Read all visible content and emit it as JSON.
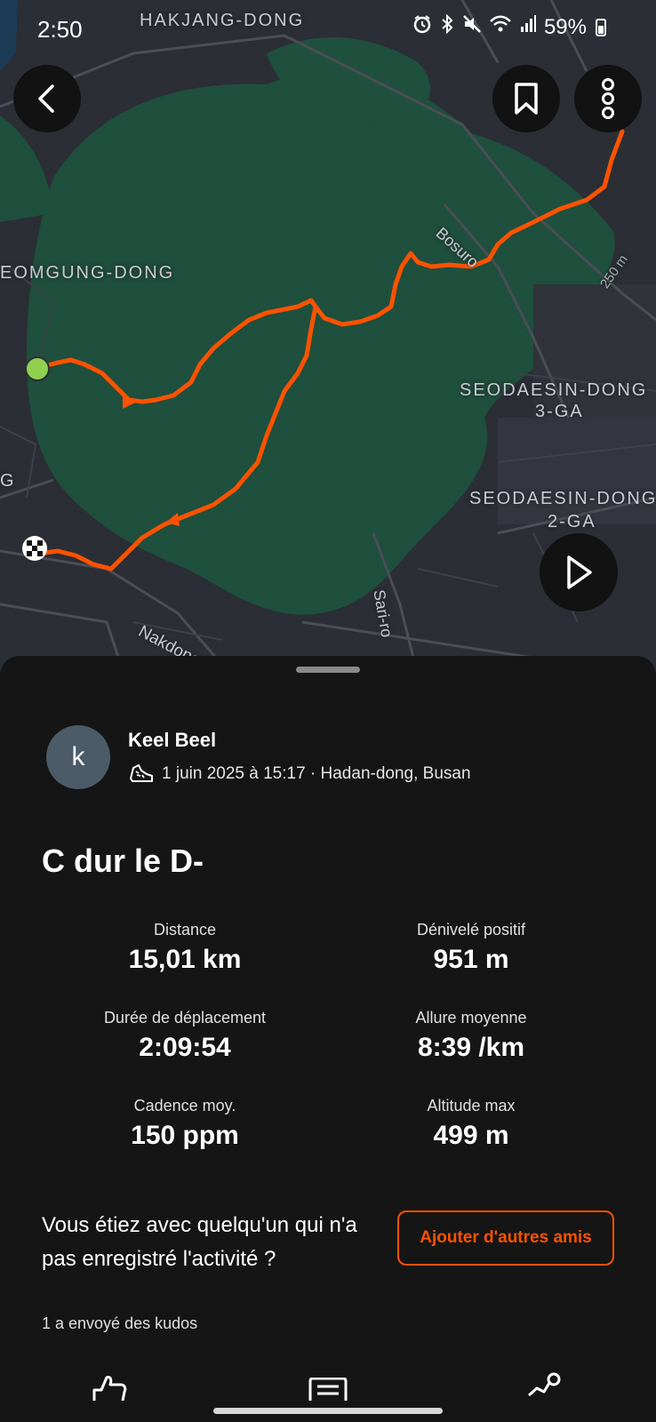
{
  "status_bar": {
    "time": "2:50",
    "battery": "59%",
    "icons": [
      "alarm-icon",
      "bluetooth-icon",
      "mute-icon",
      "wifi-icon",
      "signal-icon",
      "battery-icon"
    ]
  },
  "map": {
    "labels": {
      "hakjang": "HAKJANG-DONG",
      "geomgung": "EOMGUNG-DONG",
      "seodaesin3_line1": "SEODAESIN-DONG",
      "seodaesin3_line2": "3-GA",
      "seodaesin2_line1": "SEODAESIN-DONG",
      "seodaesin2_line2": "2-GA",
      "bosuro": "Bosuro",
      "sariro": "Sari-ro",
      "nakdong": "Nakdong-daero",
      "contour": "250 m",
      "edge_g": "G"
    },
    "route_color": "#fc5200",
    "park_color": "#1f4f3d",
    "start_marker_color": "#8fd14f"
  },
  "buttons": {
    "back": "back-icon",
    "bookmark": "bookmark-icon",
    "more": "more-icon",
    "play": "play-icon"
  },
  "athlete": {
    "avatar_letter": "k",
    "name": "Keel Beel",
    "meta": "1 juin 2025 à 15:17 · Hadan-dong, Busan"
  },
  "activity": {
    "title": "C dur le D-"
  },
  "stats": [
    {
      "label": "Distance",
      "value": "15,01 km"
    },
    {
      "label": "Dénivelé positif",
      "value": "951 m"
    },
    {
      "label": "Durée de déplacement",
      "value": "2:09:54"
    },
    {
      "label": "Allure moyenne",
      "value": "8:39 /km"
    },
    {
      "label": "Cadence moy.",
      "value": "150 ppm"
    },
    {
      "label": "Altitude max",
      "value": "499 m"
    }
  ],
  "friends": {
    "prompt": "Vous étiez avec quelqu'un qui n'a pas enregistré l'activité ?",
    "button": "Ajouter d'autres amis"
  },
  "kudos": {
    "text": "1 a envoyé des kudos"
  },
  "actions": [
    "kudos-icon",
    "comment-icon",
    "share-icon"
  ],
  "colors": {
    "accent": "#fc5200",
    "background": "#151515",
    "map_background": "#2b2e35"
  }
}
